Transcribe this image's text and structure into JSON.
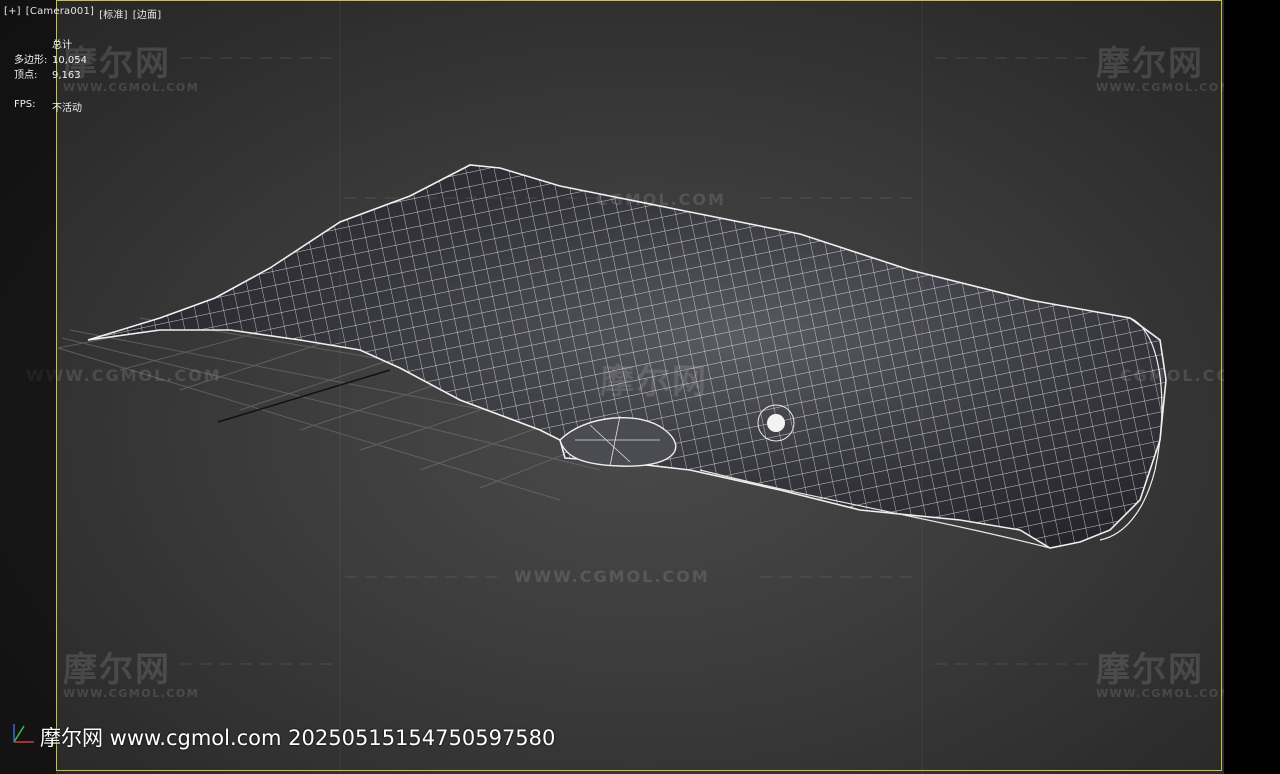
{
  "viewport": {
    "label_items": [
      "[+]",
      "[Camera001]",
      "[标准]",
      "[边面]"
    ]
  },
  "stats": {
    "header": "总计",
    "polygons_label": "多边形:",
    "polygons_value": "10,054",
    "vertices_label": "顶点:",
    "vertices_value": "9,163",
    "fps_label": "FPS:",
    "fps_value": "不活动"
  },
  "watermarks": {
    "logo_text": "摩尔网",
    "logo_sub": "WWW.CGMOL.COM",
    "url_text": "WWW.CGMOL.COM",
    "url_fragment": "CGMOL.COM",
    "footer": "摩尔网 www.cgmol.com 20250515154750597580"
  },
  "colors": {
    "safe_frame": "#c9c23a",
    "wire": "#e8e8e8",
    "mesh_fill": "#3c3c44"
  },
  "icons": {
    "axis_gizmo": "axis-tripod-icon"
  }
}
